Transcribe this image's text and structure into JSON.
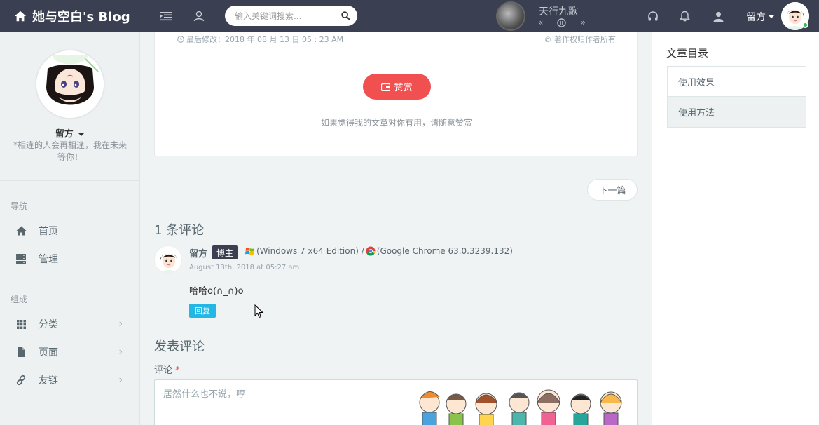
{
  "header": {
    "brand": "她与空白's Blog",
    "search_placeholder": "输入关键词搜索...",
    "player_title": "天行九歌",
    "user_name": "留方",
    "colors": {
      "bar": "#3a3f51",
      "online": "#27c24c"
    }
  },
  "sidebar": {
    "profile_name": "留方",
    "profile_motto": "*相逢的人会再相逢，我在未来等你！",
    "nav_header": "导航",
    "group_header": "组成",
    "items": [
      {
        "label": "首页",
        "icon": "home-icon"
      },
      {
        "label": "管理",
        "icon": "server-icon"
      },
      {
        "label": "分类",
        "icon": "grid-icon"
      },
      {
        "label": "页面",
        "icon": "file-icon"
      },
      {
        "label": "友链",
        "icon": "link-icon"
      }
    ]
  },
  "post": {
    "modified": "最后修改：2018 年 08 月 13 日 05 : 23 AM",
    "copyright": "© 著作权归作者所有",
    "reward_label": "赞赏",
    "reward_hint": "如果觉得我的文章对你有用，请随意赞赏",
    "next_label": "下一篇"
  },
  "comments": {
    "title": "1 条评论",
    "list": [
      {
        "author": "留方",
        "badge": "博主",
        "os": "(Windows 7 x64 Edition) /",
        "browser": "(Google Chrome 63.0.3239.132)",
        "date": "August 13th, 2018 at 05:27 am",
        "body": "哈哈o(∩_∩)o",
        "reply_label": "回复"
      }
    ]
  },
  "form": {
    "title": "发表评论",
    "field_label": "评论",
    "required_mark": "*",
    "placeholder": "居然什么也不说，哼"
  },
  "toc": {
    "title": "文章目录",
    "items": [
      {
        "label": "使用效果",
        "active": false
      },
      {
        "label": "使用方法",
        "active": true
      }
    ]
  }
}
